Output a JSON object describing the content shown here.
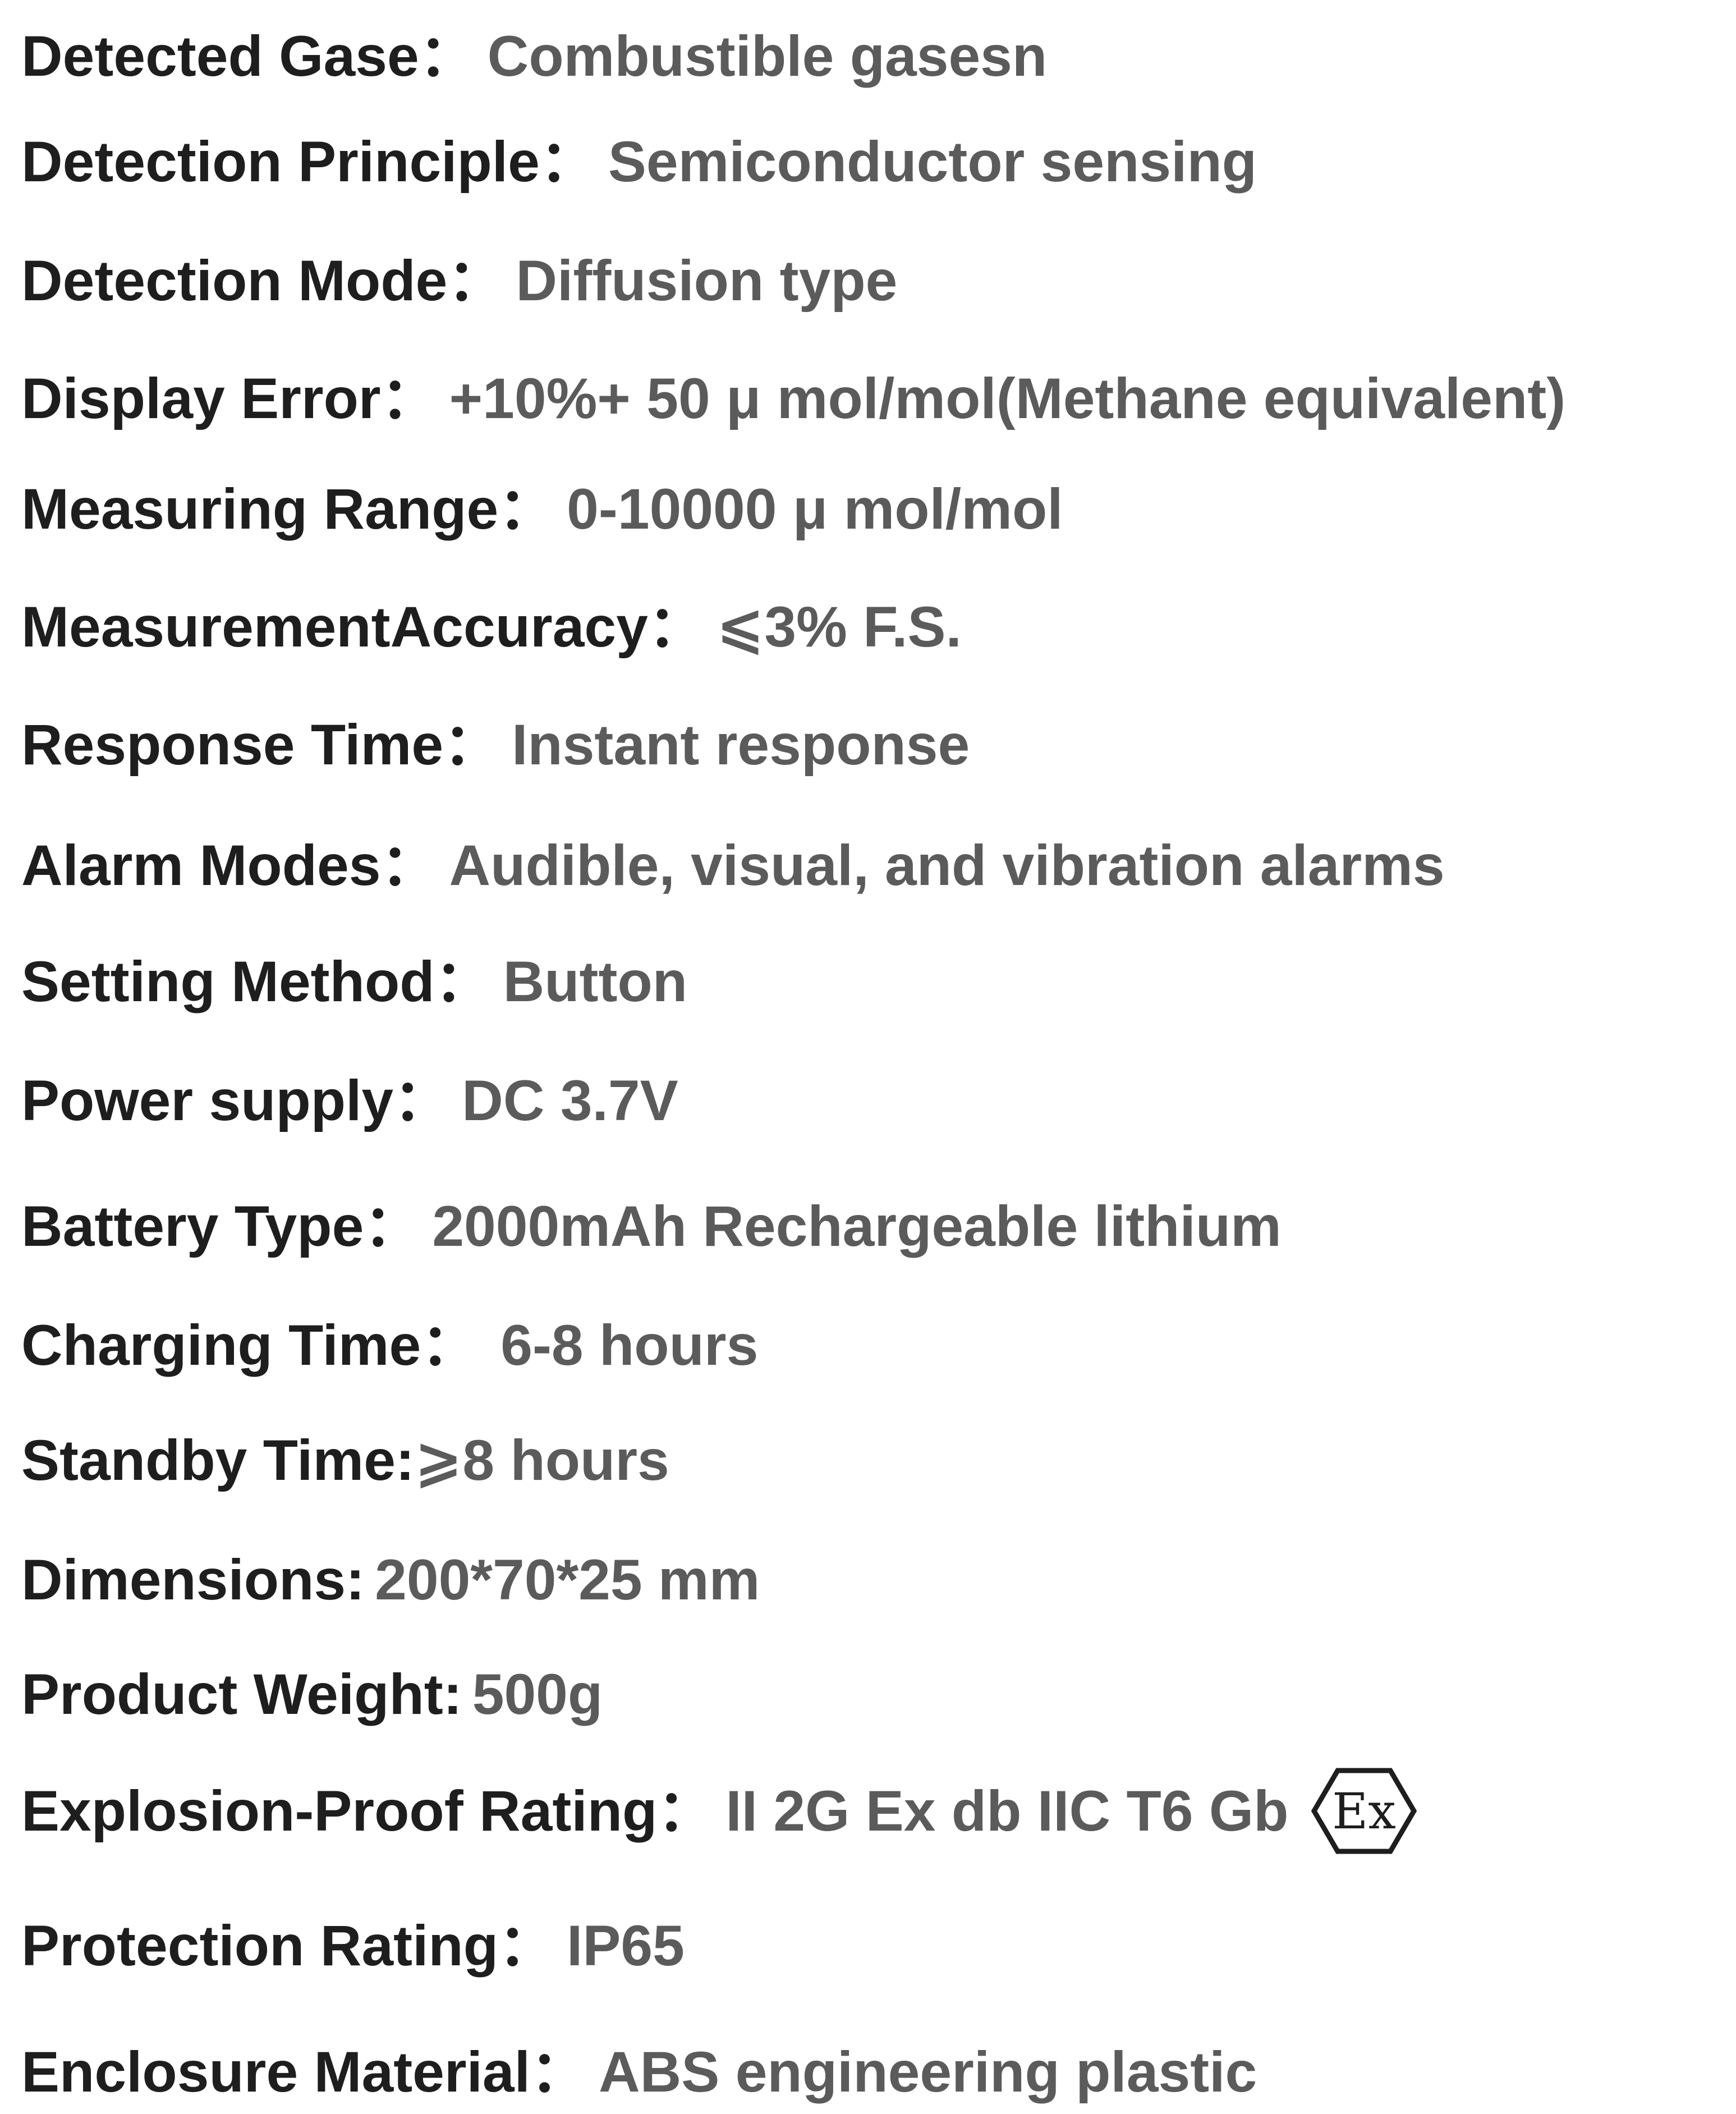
{
  "specs": [
    {
      "label": "Detected Gase：",
      "value": "Combustible gasesn"
    },
    {
      "label": "Detection Principle：",
      "value": "Semiconductor sensing"
    },
    {
      "label": "Detection Mode：",
      "value": "Diffusion type"
    },
    {
      "label": "Display Error：",
      "value": "+10%+ 50 μ mol/mol(Methane equivalent)"
    },
    {
      "label": "Measuring Range：",
      "value": "0-10000 μ mol/mol"
    },
    {
      "label": "MeasurementAccuracy：",
      "value": "⩽3% F.S."
    },
    {
      "label": "Response Time：",
      "value": "Instant response"
    },
    {
      "label": "Alarm Modes：",
      "value": "Audible, visual, and vibration alarms"
    },
    {
      "label": "Setting Method：",
      "value": "Button"
    },
    {
      "label": "Power supply：",
      "value": "DC 3.7V"
    },
    {
      "label": "Battery Type：",
      "value": "2000mAh Rechargeable lithium"
    },
    {
      "label": "Charging Time：",
      "value": "6-8 hours"
    },
    {
      "label": "Standby Time:",
      "value": "⩾8 hours"
    },
    {
      "label": "Dimensions:",
      "value": "200*70*25 mm"
    },
    {
      "label": "Product Weight:",
      "value": "500g"
    },
    {
      "label": "Explosion-Proof Rating：",
      "value": "II 2G Ex db IIC T6 Gb",
      "icon": "ex-hexagon-icon",
      "icon_text": "Ex"
    },
    {
      "label": "Protection Rating：",
      "value": "IP65"
    },
    {
      "label": "Enclosure Material：",
      "value": "ABS engineering plastic"
    }
  ]
}
